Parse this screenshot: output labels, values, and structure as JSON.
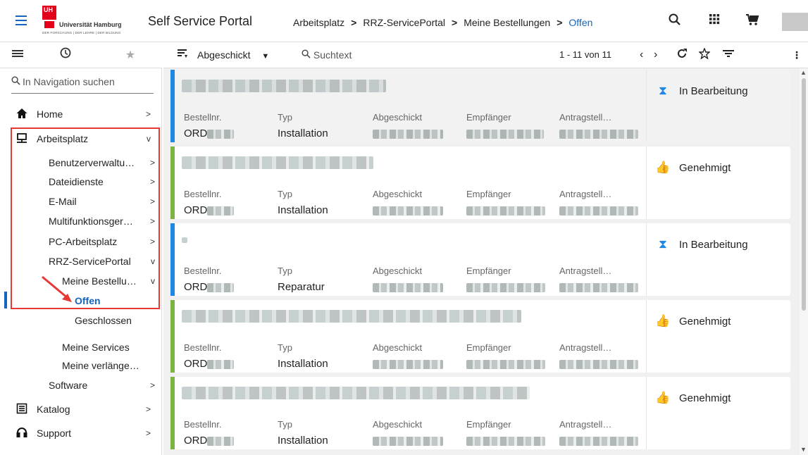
{
  "header": {
    "logo_mark": "UH",
    "logo_name": "Universität Hamburg",
    "logo_tagline": "DER FORSCHUNG | DER LEHRE | DER BILDUNG",
    "portal_title": "Self Service Portal",
    "breadcrumb": [
      "Arbeitsplatz",
      "RRZ-ServicePortal",
      "Meine Bestellungen",
      "Offen"
    ],
    "breadcrumb_sep": ">",
    "icons": [
      "search-icon",
      "apps-grid-icon",
      "cart-icon",
      "user-avatar"
    ]
  },
  "side_tabs": [
    "list-icon",
    "history-icon",
    "star-icon"
  ],
  "nav": {
    "search_placeholder": "In Navigation suchen",
    "items": [
      {
        "label": "Home",
        "icon": "home-icon",
        "chevron": ">"
      },
      {
        "label": "Arbeitsplatz",
        "icon": "desktop-icon",
        "chevron": "v"
      },
      {
        "label": "Benutzerverwaltu…",
        "chevron": ">"
      },
      {
        "label": "Dateidienste",
        "chevron": ">"
      },
      {
        "label": "E-Mail",
        "chevron": ">"
      },
      {
        "label": "Multifunktionsger…",
        "chevron": ">"
      },
      {
        "label": "PC-Arbeitsplatz",
        "chevron": ">"
      },
      {
        "label": "RRZ-ServicePortal",
        "chevron": "v"
      },
      {
        "label": "Meine Bestellu…",
        "chevron": "v"
      },
      {
        "label": "Offen"
      },
      {
        "label": "Geschlossen"
      },
      {
        "label": "Meine Services"
      },
      {
        "label": "Meine verlänge…"
      },
      {
        "label": "Software",
        "chevron": ">"
      },
      {
        "label": "Katalog",
        "icon": "catalog-icon",
        "chevron": ">"
      },
      {
        "label": "Support",
        "icon": "headset-icon",
        "chevron": ">"
      }
    ]
  },
  "toolbar": {
    "sort_label": "Abgeschickt",
    "search_placeholder": "Suchtext",
    "paging": "1 - 11 von 11"
  },
  "labels": {
    "order": "Bestellnr.",
    "type": "Typ",
    "sent": "Abgeschickt",
    "recipient": "Empfänger",
    "applicant": "Antragstell…"
  },
  "orders": [
    {
      "order_prefix": "ORD",
      "type": "Installation",
      "status": "In Bearbeitung",
      "status_icon": "hourglass-icon",
      "stripe": "#1e88e5"
    },
    {
      "order_prefix": "ORD",
      "type": "Installation",
      "status": "Genehmigt",
      "status_icon": "thumbs-up-icon",
      "stripe": "#7cb342"
    },
    {
      "order_prefix": "ORD",
      "type": "Reparatur",
      "status": "In Bearbeitung",
      "status_icon": "hourglass-icon",
      "stripe": "#1e88e5"
    },
    {
      "order_prefix": "ORD",
      "type": "Installation",
      "status": "Genehmigt",
      "status_icon": "thumbs-up-icon",
      "stripe": "#7cb342"
    },
    {
      "order_prefix": "ORD",
      "type": "Installation",
      "status": "Genehmigt",
      "status_icon": "thumbs-up-icon",
      "stripe": "#7cb342"
    }
  ],
  "colors": {
    "accent": "#1565c0",
    "approved": "#7cb342",
    "in_progress": "#1e88e5",
    "highlight": "#e53935"
  }
}
